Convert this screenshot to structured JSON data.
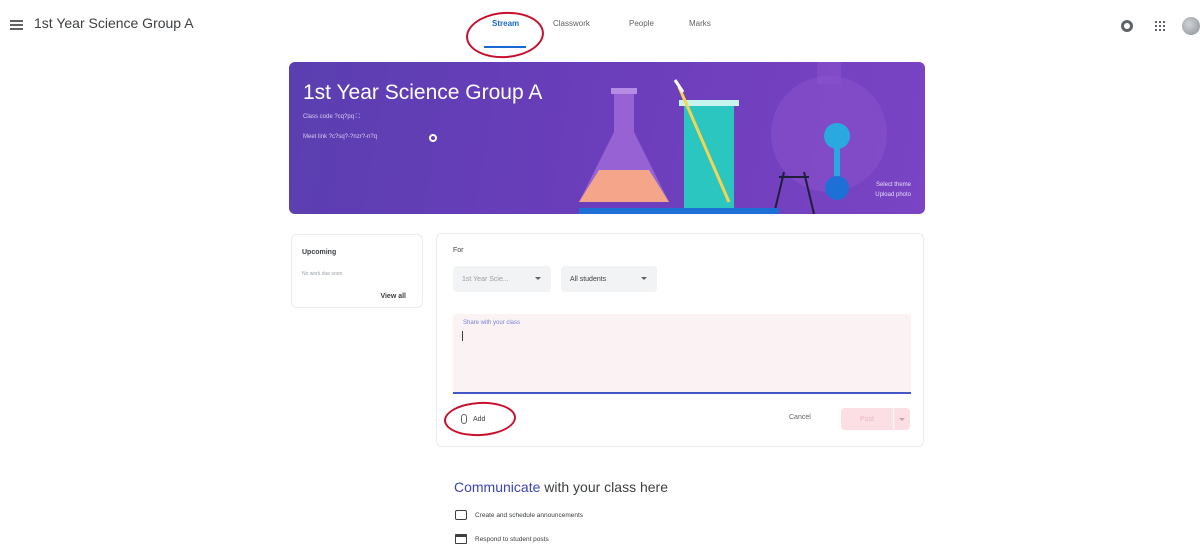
{
  "app": {
    "class_title": "1st Year Science Group A"
  },
  "tabs": [
    {
      "label": "Stream",
      "active": true
    },
    {
      "label": "Classwork",
      "active": false
    },
    {
      "label": "People",
      "active": false
    },
    {
      "label": "Marks",
      "active": false
    }
  ],
  "header_icons": {
    "menu": "hamburger-menu-icon",
    "settings": "gear-icon",
    "apps": "apps-grid-icon",
    "account": "avatar"
  },
  "banner": {
    "title": "1st Year Science Group A",
    "class_code": "Class code ?cq?pq ⛶",
    "meet_link": "Meet link ?c?sq?-?nzr?-n?q",
    "select_theme": "Select theme",
    "upload_photo": "Upload photo",
    "gradient_colors": [
      "#5a3fb0",
      "#7a44c4"
    ]
  },
  "upcoming": {
    "title": "Upcoming",
    "empty_text": "No work due soon",
    "view_all": "View all"
  },
  "composer": {
    "for_label": "For",
    "class_dropdown": "1st Year Scie...",
    "audience_dropdown": "All students",
    "placeholder": "Share with your class",
    "add_label": "Add",
    "cancel_label": "Cancel",
    "post_label": "Post",
    "accent_color": "#4556c9"
  },
  "communicate": {
    "title_part1": "Communicate",
    "title_part2": " with your class here",
    "items": [
      {
        "label": "Create and schedule announcements",
        "icon": "chat-bubble-icon"
      },
      {
        "label": "Respond to student posts",
        "icon": "inbox-icon"
      }
    ]
  },
  "annotations": {
    "color": "#c8102e",
    "circled": [
      "Stream",
      "Add"
    ]
  }
}
